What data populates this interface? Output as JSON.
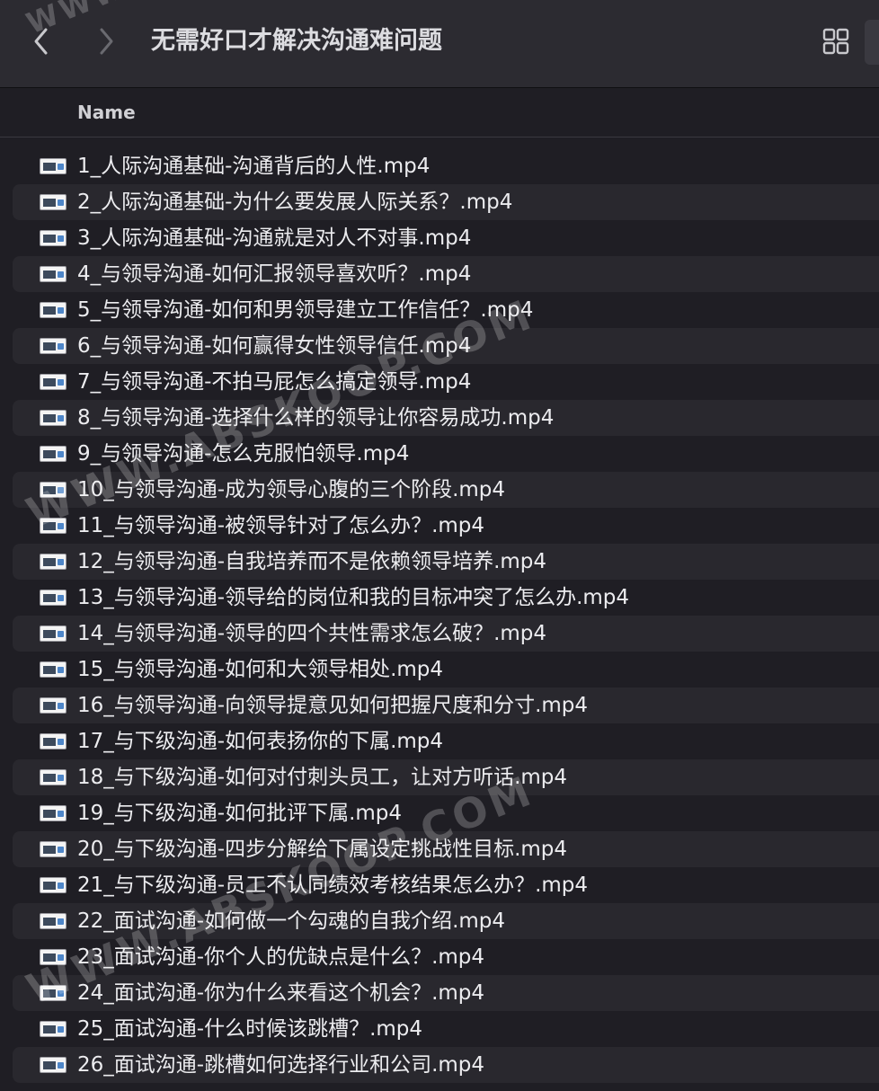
{
  "window": {
    "title": "无需好口才解决沟通难问题"
  },
  "toolbar": {
    "back_icon": "chevron-left-icon",
    "forward_icon": "chevron-right-icon",
    "view_icon": "grid-view-icon"
  },
  "columns": {
    "name": "Name"
  },
  "files": [
    "1_人际沟通基础-沟通背后的人性.mp4",
    "2_人际沟通基础-为什么要发展人际关系？.mp4",
    "3_人际沟通基础-沟通就是对人不对事.mp4",
    "4_与领导沟通-如何汇报领导喜欢听？.mp4",
    "5_与领导沟通-如何和男领导建立工作信任？.mp4",
    "6_与领导沟通-如何赢得女性领导信任.mp4",
    "7_与领导沟通-不拍马屁怎么搞定领导.mp4",
    "8_与领导沟通-选择什么样的领导让你容易成功.mp4",
    "9_与领导沟通-怎么克服怕领导.mp4",
    "10_与领导沟通-成为领导心腹的三个阶段.mp4",
    "11_与领导沟通-被领导针对了怎么办？.mp4",
    "12_与领导沟通-自我培养而不是依赖领导培养.mp4",
    "13_与领导沟通-领导给的岗位和我的目标冲突了怎么办.mp4",
    "14_与领导沟通-领导的四个共性需求怎么破？.mp4",
    "15_与领导沟通-如何和大领导相处.mp4",
    "16_与领导沟通-向领导提意见如何把握尺度和分寸.mp4",
    "17_与下级沟通-如何表扬你的下属.mp4",
    "18_与下级沟通-如何对付刺头员工，让对方听话.mp4",
    "19_与下级沟通-如何批评下属.mp4",
    "20_与下级沟通-四步分解给下属设定挑战性目标.mp4",
    "21_与下级沟通-员工不认同绩效考核结果怎么办？.mp4",
    "22_面试沟通-如何做一个勾魂的自我介绍.mp4",
    "23_面试沟通-你个人的优缺点是什么？.mp4",
    "24_面试沟通-你为什么来看这个机会？.mp4",
    "25_面试沟通-什么时候该跳槽？.mp4",
    "26_面试沟通-跳槽如何选择行业和公司.mp4"
  ],
  "file_icon": "video-file-icon",
  "watermarks": [
    "WWW.ABSKOOP.COM",
    "WWW.ABSKOOP.COM",
    "WWW"
  ],
  "colors": {
    "background": "#1f1e24",
    "toolbar": "#2c2b31",
    "row_alt": "#29282e",
    "text": "#ececef"
  }
}
